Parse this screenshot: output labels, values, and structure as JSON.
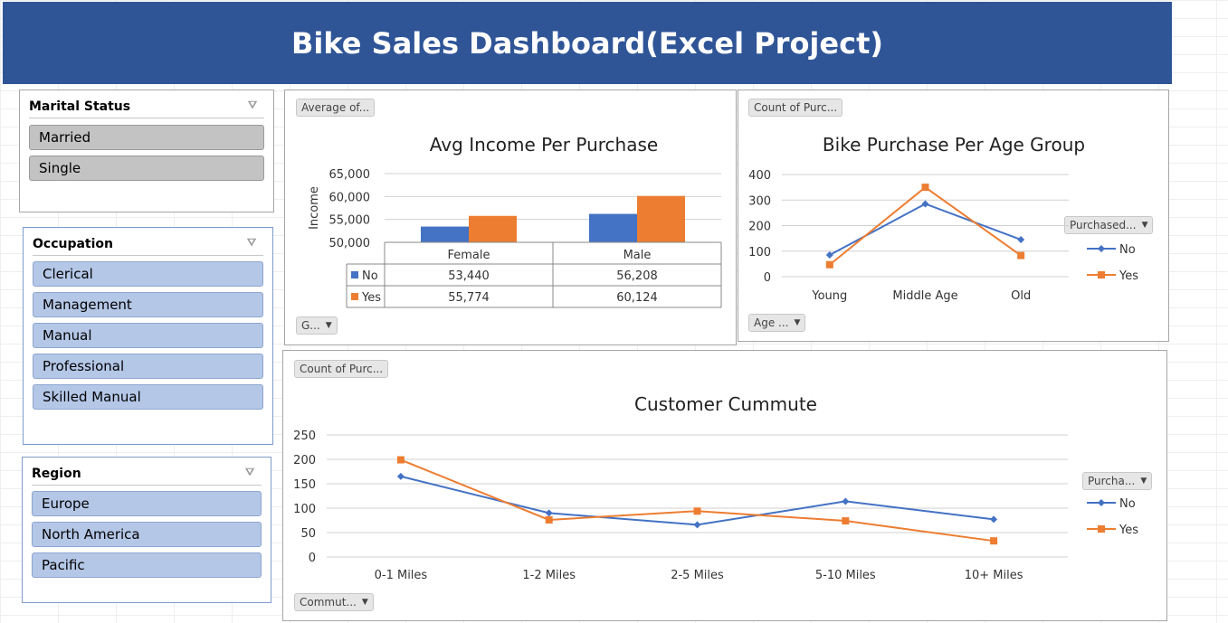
{
  "header": {
    "title": "Bike Sales Dashboard(Excel Project)"
  },
  "slicers": {
    "marital": {
      "title": "Marital Status",
      "items": [
        "Married",
        "Single"
      ]
    },
    "occupation": {
      "title": "Occupation",
      "items": [
        "Clerical",
        "Management",
        "Manual",
        "Professional",
        "Skilled Manual"
      ]
    },
    "region": {
      "title": "Region",
      "items": [
        "Europe",
        "North America",
        "Pacific"
      ]
    }
  },
  "field_buttons": {
    "income_value": "Average of...",
    "income_axis": "G...",
    "age_value": "Count of Purc...",
    "age_axis": "Age ...",
    "age_legend": "Purchased...",
    "commute_value": "Count of Purc...",
    "commute_axis": "Commut...",
    "commute_legend": "Purcha..."
  },
  "chart_data": [
    {
      "type": "bar",
      "title": "Avg Income Per Purchase",
      "ylabel": "Income",
      "categories": [
        "Female",
        "Male"
      ],
      "series": [
        {
          "name": "No",
          "values": [
            53440,
            56208
          ],
          "labels": [
            "53,440",
            "56,208"
          ],
          "color": "#4472c4"
        },
        {
          "name": "Yes",
          "values": [
            55774,
            60124
          ],
          "labels": [
            "55,774",
            "60,124"
          ],
          "color": "#ed7d31"
        }
      ],
      "ylim": [
        50000,
        65000
      ],
      "yticks": [
        "50,000",
        "55,000",
        "60,000",
        "65,000"
      ],
      "data_table": true
    },
    {
      "type": "line",
      "title": "Bike Purchase Per Age Group",
      "categories": [
        "Young",
        "Middle Age",
        "Old"
      ],
      "series": [
        {
          "name": "No",
          "values": [
            85,
            285,
            145
          ],
          "color": "#4472c4"
        },
        {
          "name": "Yes",
          "values": [
            47,
            350,
            83
          ],
          "color": "#ed7d31"
        }
      ],
      "ylim": [
        0,
        400
      ],
      "yticks": [
        "0",
        "100",
        "200",
        "300",
        "400"
      ],
      "legend": "right"
    },
    {
      "type": "line",
      "title": "Customer Cummute",
      "categories": [
        "0-1 Miles",
        "1-2 Miles",
        "2-5 Miles",
        "5-10 Miles",
        "10+ Miles"
      ],
      "series": [
        {
          "name": "No",
          "values": [
            165,
            90,
            66,
            114,
            77
          ],
          "color": "#4472c4"
        },
        {
          "name": "Yes",
          "values": [
            199,
            76,
            94,
            74,
            33
          ],
          "color": "#ed7d31"
        }
      ],
      "ylim": [
        0,
        250
      ],
      "yticks": [
        "0",
        "50",
        "100",
        "150",
        "200",
        "250"
      ],
      "legend": "right"
    }
  ]
}
